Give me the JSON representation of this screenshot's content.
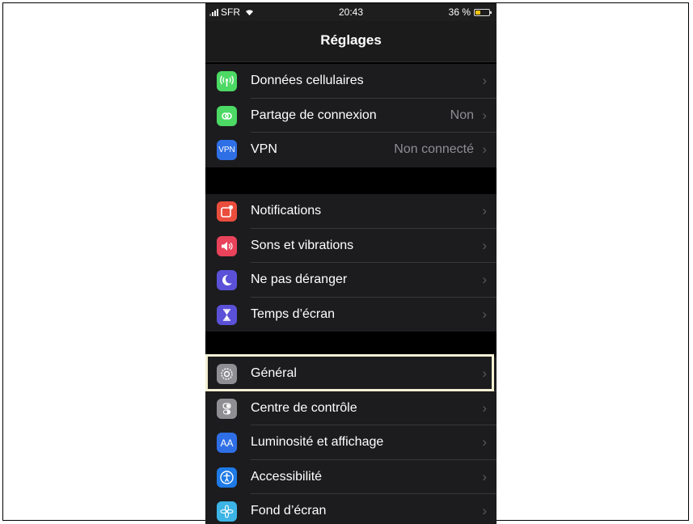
{
  "status_bar": {
    "carrier": "SFR",
    "time": "20:43",
    "battery": "36 %",
    "battery_level": 0.36
  },
  "nav": {
    "title": "Réglages"
  },
  "colors": {
    "cellular": "#4cd964",
    "hotspot": "#4cd964",
    "vpn": "#2f6fe6",
    "notifications": "#eb4d3d",
    "sounds": "#e8435a",
    "dnd": "#5b51d8",
    "screen_time": "#5b51d8",
    "general": "#8e8e93",
    "control_center": "#8e8e93",
    "display": "#2f6fe6",
    "accessibility": "#1e7ae6",
    "wallpaper": "#3cb4e6",
    "highlight": "#f2efd3"
  },
  "groups": [
    {
      "items": [
        {
          "label": "Données cellulaires",
          "value": "",
          "icon": "antenna-icon"
        },
        {
          "label": "Partage de connexion",
          "value": "Non",
          "icon": "hotspot-icon"
        },
        {
          "label": "VPN",
          "value": "Non connecté",
          "icon": "vpn-icon",
          "icon_text": "VPN"
        }
      ]
    },
    {
      "items": [
        {
          "label": "Notifications",
          "value": "",
          "icon": "notifications-icon"
        },
        {
          "label": "Sons et vibrations",
          "value": "",
          "icon": "speaker-icon"
        },
        {
          "label": "Ne pas déranger",
          "value": "",
          "icon": "moon-icon"
        },
        {
          "label": "Temps d’écran",
          "value": "",
          "icon": "hourglass-icon"
        }
      ]
    },
    {
      "items": [
        {
          "label": "Général",
          "value": "",
          "icon": "gear-icon"
        },
        {
          "label": "Centre de contrôle",
          "value": "",
          "icon": "toggles-icon"
        },
        {
          "label": "Luminosité et affichage",
          "value": "",
          "icon": "text-size-icon",
          "icon_text": "AA"
        },
        {
          "label": "Accessibilité",
          "value": "",
          "icon": "accessibility-icon"
        },
        {
          "label": "Fond d’écran",
          "value": "",
          "icon": "flower-icon"
        }
      ]
    }
  ]
}
